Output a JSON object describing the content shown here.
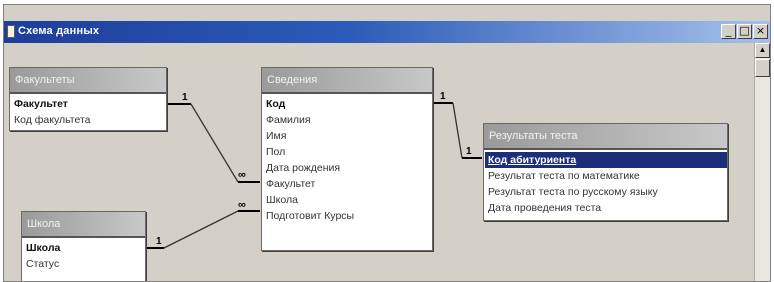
{
  "window": {
    "title": "Схема данных",
    "controls": {
      "minimize": "_",
      "maximize": "□",
      "close": "×"
    }
  },
  "scrollbar": {
    "up_arrow": "▲"
  },
  "tables": {
    "faculties": {
      "title": "Факультеты",
      "fields": [
        "Факультет",
        "Код факультета"
      ]
    },
    "info": {
      "title": "Сведения",
      "fields": [
        "Код",
        "Фамилия",
        "Имя",
        "Пол",
        "Дата рождения",
        "Факультет",
        "Школа",
        "Подготовит Курсы"
      ]
    },
    "results": {
      "title": "Результаты теста",
      "fields": [
        "Код абитуриента",
        "Результат теста по математике",
        "Результат теста по русскому языку",
        "Дата проведения теста"
      ]
    },
    "school": {
      "title": "Школа",
      "fields": [
        "Школа",
        "Статус"
      ]
    }
  },
  "relations": {
    "one": "1",
    "many": "∞"
  }
}
